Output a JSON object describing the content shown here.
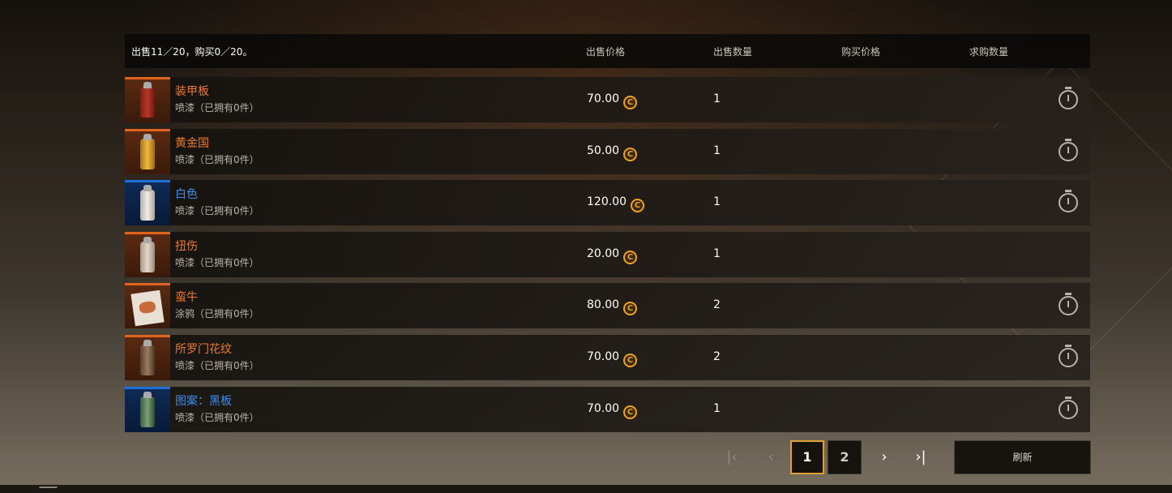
{
  "header": {
    "summary": "出售11／20，购买0／20。",
    "col_sell_price": "出售价格",
    "col_sell_qty": "出售数量",
    "col_buy_price": "购买价格",
    "col_buy_qty": "求购数量"
  },
  "rows": [
    {
      "name": "装甲板",
      "type": "喷漆（已拥有0件）",
      "price": "70.00",
      "qty": "1",
      "rarity": "orange",
      "item_icon": "red-spray-can",
      "timer": true
    },
    {
      "name": "黄金国",
      "type": "喷漆（已拥有0件）",
      "price": "50.00",
      "qty": "1",
      "rarity": "orange",
      "item_icon": "yellow-spray-can",
      "timer": true
    },
    {
      "name": "白色",
      "type": "喷漆（已拥有0件）",
      "price": "120.00",
      "qty": "1",
      "rarity": "blue",
      "item_icon": "white-spray-can",
      "timer": true
    },
    {
      "name": "扭伤",
      "type": "喷漆（已拥有0件）",
      "price": "20.00",
      "qty": "1",
      "rarity": "orange",
      "item_icon": "beige-spray-can",
      "timer": false
    },
    {
      "name": "蛮牛",
      "type": "涂鸦（已拥有0件）",
      "price": "80.00",
      "qty": "2",
      "rarity": "orange",
      "item_icon": "bull-graffiti",
      "timer": true
    },
    {
      "name": "所罗门花纹",
      "type": "喷漆（已拥有0件）",
      "price": "70.00",
      "qty": "2",
      "rarity": "orange",
      "item_icon": "brown-spray-can",
      "timer": true
    },
    {
      "name": "图案：黑板",
      "type": "喷漆（已拥有0件）",
      "price": "70.00",
      "qty": "1",
      "rarity": "blue",
      "item_icon": "green-spray-can",
      "timer": true
    }
  ],
  "pagination": {
    "first_icon": "first-page-icon",
    "prev_icon": "prev-page-icon",
    "pages": [
      "1",
      "2"
    ],
    "current_page": "1",
    "next_icon": "next-page-icon",
    "last_icon": "last-page-icon"
  },
  "refresh_label": "刷新",
  "colors": {
    "rarity_orange": "#e0641c",
    "rarity_blue": "#1e6fd9",
    "coin": "#f0a020"
  }
}
